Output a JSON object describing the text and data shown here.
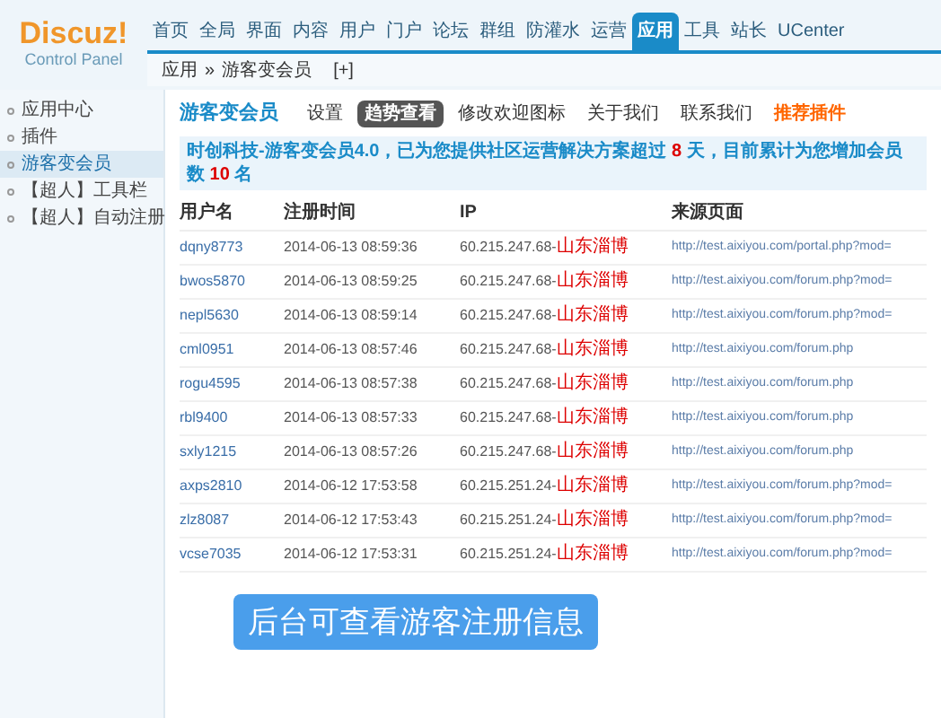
{
  "logo": {
    "name": "Discuz!",
    "subtitle": "Control Panel"
  },
  "nav": [
    {
      "label": "首页",
      "selected": false
    },
    {
      "label": "全局",
      "selected": false
    },
    {
      "label": "界面",
      "selected": false
    },
    {
      "label": "内容",
      "selected": false
    },
    {
      "label": "用户",
      "selected": false
    },
    {
      "label": "门户",
      "selected": false
    },
    {
      "label": "论坛",
      "selected": false
    },
    {
      "label": "群组",
      "selected": false
    },
    {
      "label": "防灌水",
      "selected": false
    },
    {
      "label": "运营",
      "selected": false
    },
    {
      "label": "应用",
      "selected": true
    },
    {
      "label": "工具",
      "selected": false
    },
    {
      "label": "站长",
      "selected": false
    },
    {
      "label": "UCenter",
      "selected": false
    }
  ],
  "breadcrumb": {
    "parent": "应用",
    "separator": "»",
    "current": "游客变会员",
    "add": "[+]"
  },
  "sidebar": {
    "items": [
      {
        "label": "应用中心",
        "selected": false
      },
      {
        "label": "插件",
        "selected": false
      },
      {
        "label": "游客变会员",
        "selected": true
      },
      {
        "label": "【超人】工具栏",
        "selected": false
      },
      {
        "label": "【超人】自动注册",
        "selected": false
      }
    ]
  },
  "page_title": "游客变会员",
  "tabs": [
    {
      "label": "设置",
      "selected": false,
      "kind": "normal"
    },
    {
      "label": "趋势查看",
      "selected": true,
      "kind": "normal"
    },
    {
      "label": "修改欢迎图标",
      "selected": false,
      "kind": "normal"
    },
    {
      "label": "关于我们",
      "selected": false,
      "kind": "normal"
    },
    {
      "label": "联系我们",
      "selected": false,
      "kind": "normal"
    },
    {
      "label": "推荐插件",
      "selected": false,
      "kind": "highlight"
    }
  ],
  "notice": {
    "before": "时创科技-游客变会员4.0，已为您提供社区运营解决方案超过",
    "days": "8",
    "middle": "天，目前累计为您增加会员数",
    "count": "10",
    "after": "名"
  },
  "table": {
    "columns": [
      "用户名",
      "注册时间",
      "IP",
      "来源页面"
    ],
    "rows": [
      {
        "username": "dqny8773",
        "time": "2014-06-13 08:59:36",
        "ip": "60.215.247.68-",
        "location": "山东淄博",
        "source": "http://test.aixiyou.com/portal.php?mod="
      },
      {
        "username": "bwos5870",
        "time": "2014-06-13 08:59:25",
        "ip": "60.215.247.68-",
        "location": "山东淄博",
        "source": "http://test.aixiyou.com/forum.php?mod="
      },
      {
        "username": "nepl5630",
        "time": "2014-06-13 08:59:14",
        "ip": "60.215.247.68-",
        "location": "山东淄博",
        "source": "http://test.aixiyou.com/forum.php?mod="
      },
      {
        "username": "cml0951",
        "time": "2014-06-13 08:57:46",
        "ip": "60.215.247.68-",
        "location": "山东淄博",
        "source": "http://test.aixiyou.com/forum.php"
      },
      {
        "username": "rogu4595",
        "time": "2014-06-13 08:57:38",
        "ip": "60.215.247.68-",
        "location": "山东淄博",
        "source": "http://test.aixiyou.com/forum.php"
      },
      {
        "username": "rbl9400",
        "time": "2014-06-13 08:57:33",
        "ip": "60.215.247.68-",
        "location": "山东淄博",
        "source": "http://test.aixiyou.com/forum.php"
      },
      {
        "username": "sxly1215",
        "time": "2014-06-13 08:57:26",
        "ip": "60.215.247.68-",
        "location": "山东淄博",
        "source": "http://test.aixiyou.com/forum.php"
      },
      {
        "username": "axps2810",
        "time": "2014-06-12 17:53:58",
        "ip": "60.215.251.24-",
        "location": "山东淄博",
        "source": "http://test.aixiyou.com/forum.php?mod="
      },
      {
        "username": "zlz8087",
        "time": "2014-06-12 17:53:43",
        "ip": "60.215.251.24-",
        "location": "山东淄博",
        "source": "http://test.aixiyou.com/forum.php?mod="
      },
      {
        "username": "vcse7035",
        "time": "2014-06-12 17:53:31",
        "ip": "60.215.251.24-",
        "location": "山东淄博",
        "source": "http://test.aixiyou.com/forum.php?mod="
      }
    ]
  },
  "caption": "后台可查看游客注册信息"
}
